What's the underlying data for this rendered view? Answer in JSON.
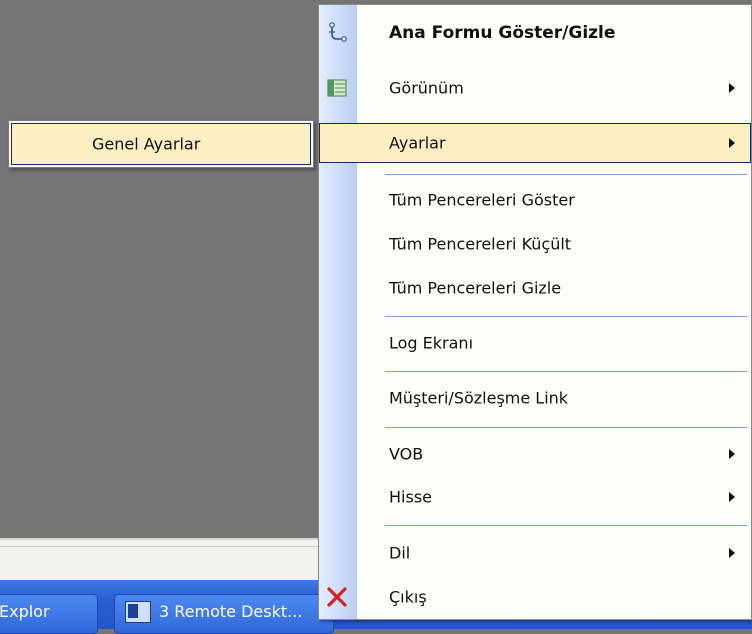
{
  "taskbar": {
    "explorer_label": "Explor",
    "remote_label": "3 Remote Deskt..."
  },
  "menu": {
    "show_hide_main": "Ana Formu Göster/Gizle",
    "view": "Görünüm",
    "settings": "Ayarlar",
    "show_all_windows": "Tüm Pencereleri Göster",
    "minimize_all_windows": "Tüm Pencereleri Küçült",
    "hide_all_windows": "Tüm Pencereleri Gizle",
    "log_screen": "Log Ekranı",
    "customer_contract_link": "Müşteri/Sözleşme Link",
    "vob": "VOB",
    "stock": "Hisse",
    "language": "Dil",
    "exit": "Çıkış"
  },
  "submenu": {
    "general_settings": "Genel Ayarlar"
  },
  "icons": {
    "show_hide": "connector-icon",
    "view": "grid-view-icon",
    "exit": "red-x-icon"
  },
  "colors": {
    "highlight": "#ffeec2",
    "gutter": "#c6d8f5",
    "separator": "#7b9ed9",
    "taskbar": "#2a5fd0"
  }
}
